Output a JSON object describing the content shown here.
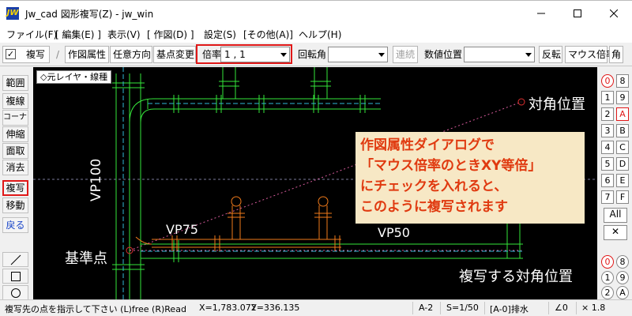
{
  "window": {
    "title": "Jw_cad 図形複写(Z) - jw_win",
    "icon_text": "JW"
  },
  "menu": [
    "ファイル(F)",
    "[ 編集(E) ]",
    "表示(V)",
    "[ 作図(D) ]",
    "設定(S)",
    "[その他(A)]",
    "ヘルプ(H)"
  ],
  "toolbar": {
    "copy_checkbox_label": "複写",
    "copy_checked": true,
    "attr_button": "作図属性",
    "direction_button": "任意方向",
    "basepoint_button": "基点変更",
    "scale_label": "倍率",
    "scale_value": "1 , 1",
    "rotation_label": "回転角",
    "rotation_value": "",
    "continuous_button": "連続",
    "numeric_pos_label": "数値位置",
    "numeric_pos_value": "",
    "flip_button": "反転",
    "mouse_scale_button": "マウス倍率",
    "angle_button": "角"
  },
  "left_tools": [
    "範囲",
    "複線",
    "コーナー",
    "伸縮",
    "面取",
    "消去",
    "複写",
    "移動",
    "戻る"
  ],
  "canvas": {
    "layer_label": "◇元レイヤ・線種",
    "labels": {
      "vp100": "VP100",
      "vp75": "VP75",
      "vp50": "VP50",
      "base_point": "基準点",
      "diagonal": "対角位置",
      "copy_diagonal": "複写する対角位置"
    },
    "callout_lines": [
      "作図属性ダイアログで",
      "「マウス倍率のときXY等倍」",
      "にチェックを入れると、",
      "このように複写されます"
    ]
  },
  "right_panel": {
    "layer_rows": [
      [
        "0",
        "8"
      ],
      [
        "1",
        "9"
      ],
      [
        "2",
        "A"
      ],
      [
        "3",
        "B"
      ],
      [
        "4",
        "C"
      ],
      [
        "5",
        "D"
      ],
      [
        "6",
        "E"
      ],
      [
        "7",
        "F"
      ]
    ],
    "all_label": "All",
    "close_label": "✕",
    "group_rows": [
      [
        "0",
        "8"
      ],
      [
        "1",
        "9"
      ],
      [
        "2",
        "A"
      ]
    ]
  },
  "status": {
    "message": "複写先の点を指示して下さい (L)free (R)Read",
    "x_label": "X=1,783.072",
    "y_label": "Y=336.135",
    "paper": "A-2",
    "scale": "S=1/50",
    "layer": "[A-0]排水",
    "angle": "∠0",
    "zoom": "× 1.8"
  },
  "colors": {
    "cad_background": "#000000",
    "green_pipe": "#35e63a",
    "orange_pipe": "#f07a1a",
    "callout_bg": "#f7e8c5",
    "callout_text": "#e03a10",
    "highlight": "#e01818"
  }
}
